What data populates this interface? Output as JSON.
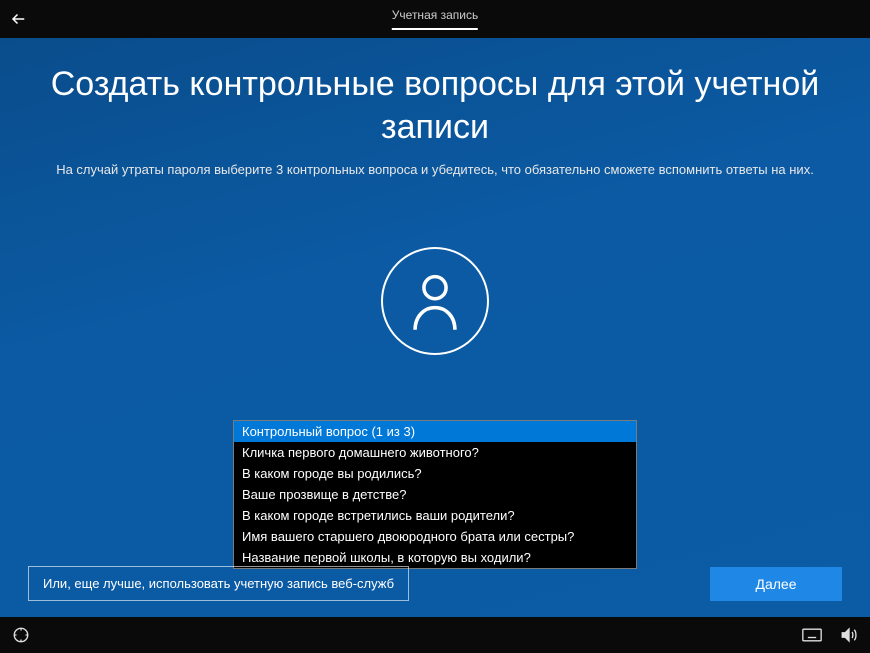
{
  "titlebar": {
    "tab_label": "Учетная запись"
  },
  "page": {
    "title": "Создать контрольные вопросы для этой учетной записи",
    "subtitle": "На случай утраты пароля выберите 3 контрольных вопроса и убедитесь, что обязательно сможете вспомнить ответы на них."
  },
  "dropdown": {
    "options": [
      "Контрольный вопрос (1 из 3)",
      "Кличка первого домашнего животного?",
      "В каком городе вы родились?",
      "Ваше прозвище в детстве?",
      "В каком городе встретились ваши родители?",
      "Имя вашего старшего двоюродного брата или сестры?",
      "Название первой школы, в которую вы ходили?"
    ],
    "selected_index": 0
  },
  "buttons": {
    "web_account_link": "Или, еще лучше, использовать учетную запись веб-служб",
    "next": "Далее"
  }
}
